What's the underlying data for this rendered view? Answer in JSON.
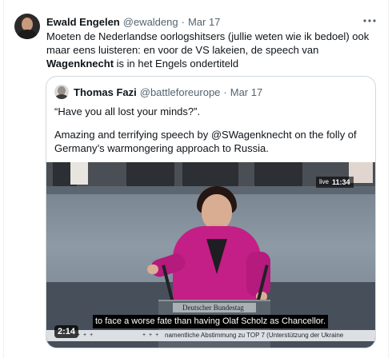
{
  "post": {
    "author_name": "Ewald Engelen",
    "author_handle": "@ewaldeng",
    "separator": "·",
    "date": "Mar 17",
    "more_icon": "more-horizontal-icon",
    "text_part1": "Moeten de  Nederlandse oorlogshitsers (jullie weten wie ik bedoel) ook maar eens luisteren: en voor de VS lakeien, de speech van ",
    "text_bold": "Wagenknecht",
    "text_part2": " is in het Engels ondertiteld"
  },
  "quoted": {
    "author_name": "Thomas Fazi",
    "author_handle": "@battleforeurope",
    "separator": "·",
    "date": "Mar 17",
    "line1": "“Have you all lost your minds?”.",
    "line2": "Amazing and terrifying speech by @SWagenknecht on the folly of Germany’s warmongering approach to Russia.",
    "video": {
      "live_label": "live",
      "clock": "11:34",
      "podium_text": "Deutscher Bundestag",
      "subtitle": "to face a worse fate than having Olaf Scholz as Chancellor.",
      "ticker_marks_left": "+ + +",
      "ticker_marks_mid": "+ + +",
      "ticker": "namentliche Abstimmung zu TOP 7 (Unterstützung der Ukraine",
      "duration": "2:14"
    }
  },
  "colors": {
    "text_primary": "#0f1419",
    "text_secondary": "#536471",
    "border": "#cfd9de",
    "jacket": "#c41f86"
  }
}
